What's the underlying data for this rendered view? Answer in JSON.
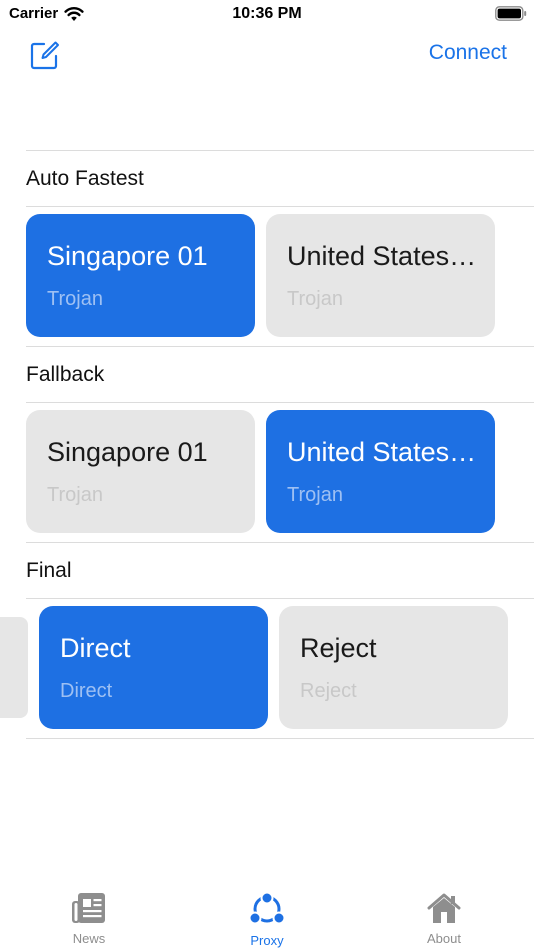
{
  "status_bar": {
    "carrier": "Carrier",
    "time": "10:36 PM"
  },
  "nav": {
    "compose_icon": "compose-icon",
    "connect_label": "Connect"
  },
  "groups": [
    {
      "title": "Auto Fastest",
      "cards": [
        {
          "name": "Singapore 01",
          "type": "Trojan",
          "selected": true
        },
        {
          "name": "United States…",
          "type": "Trojan",
          "selected": false
        }
      ]
    },
    {
      "title": "Fallback",
      "cards": [
        {
          "name": "Singapore 01",
          "type": "Trojan",
          "selected": false
        },
        {
          "name": "United States…",
          "type": "Trojan",
          "selected": true
        }
      ]
    },
    {
      "title": "Final",
      "cards": [
        {
          "name": "Direct",
          "type": "Direct",
          "selected": true
        },
        {
          "name": "Reject",
          "type": "Reject",
          "selected": false
        }
      ]
    }
  ],
  "tabs": [
    {
      "label": "News",
      "icon": "newspaper-icon",
      "active": false
    },
    {
      "label": "Proxy",
      "icon": "share-nodes-icon",
      "active": true
    },
    {
      "label": "About",
      "icon": "house-icon",
      "active": false
    }
  ],
  "colors": {
    "accent": "#1e70e3",
    "link": "#1a73e8",
    "unselected": "#e6e6e6"
  }
}
